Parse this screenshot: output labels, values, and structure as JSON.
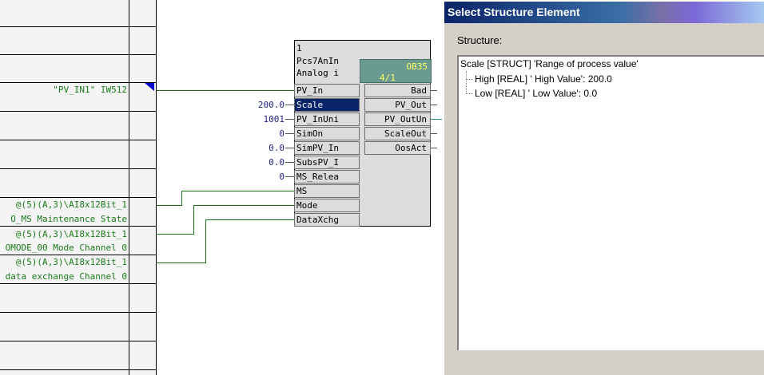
{
  "margin": {
    "labels": [
      {
        "text": "\"PV_IN1\" IW512"
      },
      {
        "text": "@(5)(A,3)\\AI8x12Bit_1"
      },
      {
        "text": "O_MS Maintenance State"
      },
      {
        "text": "@(5)(A,3)\\AI8x12Bit_1"
      },
      {
        "text": "OMODE_00 Mode Channel 0"
      },
      {
        "text": "@(5)(A,3)\\AI8x12Bit_1"
      },
      {
        "text": "data exchange Channel 0"
      }
    ]
  },
  "block": {
    "number": "1",
    "type": "Pcs7AnIn",
    "comment": "Analog i",
    "ob_label": "OB35",
    "ob_sequence": "4/1",
    "inputs": [
      {
        "name": "PV_In",
        "value": ""
      },
      {
        "name": "Scale",
        "value": "200.0",
        "selected": true
      },
      {
        "name": "PV_InUni",
        "value": "1001"
      },
      {
        "name": "SimOn",
        "value": "0"
      },
      {
        "name": "SimPV_In",
        "value": "0.0"
      },
      {
        "name": "SubsPV_I",
        "value": "0.0"
      },
      {
        "name": "MS_Relea",
        "value": "0"
      },
      {
        "name": "MS",
        "value": ""
      },
      {
        "name": "Mode",
        "value": ""
      },
      {
        "name": "DataXchg",
        "value": ""
      }
    ],
    "outputs": [
      {
        "name": "Bad"
      },
      {
        "name": "PV_Out"
      },
      {
        "name": "PV_OutUn"
      },
      {
        "name": "ScaleOut"
      },
      {
        "name": "OosAct"
      }
    ]
  },
  "dialog": {
    "title": "Select Structure Element",
    "structure_label": "Structure:",
    "tree": {
      "root": "Scale [STRUCT] 'Range of process value'",
      "children": [
        "High [REAL] ' High Value':  200.0",
        "Low [REAL] ' Low Value':  0.0"
      ]
    }
  },
  "colors": {
    "selected_bg": "#0a246a",
    "wire": "#1a7a1a",
    "block_bg": "#dcdcdc",
    "ob_bg": "#6b9a91",
    "ob_text": "#ffff66"
  }
}
